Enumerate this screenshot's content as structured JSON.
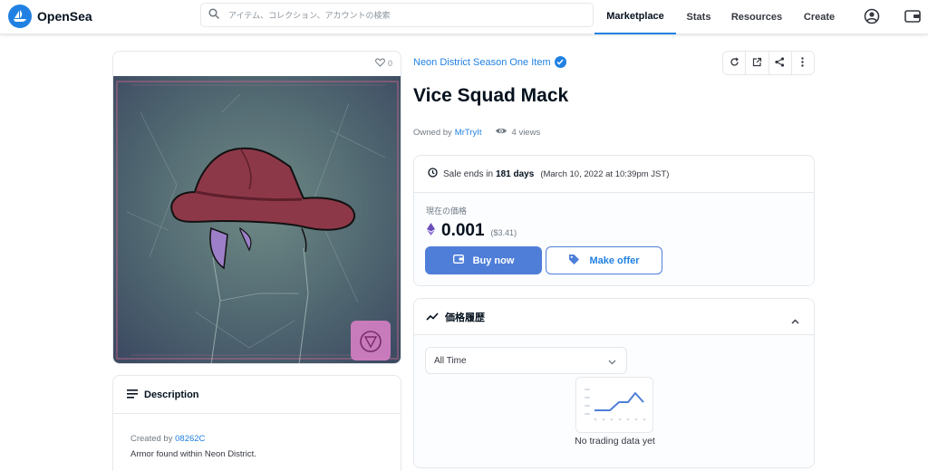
{
  "header": {
    "brand": "OpenSea",
    "search_placeholder": "アイテム、コレクション、アカウントの検索",
    "nav": [
      "Marketplace",
      "Stats",
      "Resources",
      "Create"
    ]
  },
  "asset": {
    "favorites_count": "0",
    "collection": "Neon District Season One Item",
    "title": "Vice Squad Mack",
    "owned_by_label": "Owned by",
    "owner": "MrTryIt",
    "views": "4 views"
  },
  "description": {
    "heading": "Description",
    "created_by_label": "Created by",
    "creator": "08262C",
    "text": "Armor found within Neon District."
  },
  "sale": {
    "ends_label": "Sale ends in",
    "ends_in": "181 days",
    "end_date": "(March 10, 2022 at 10:39pm JST)",
    "price_label": "現在の価格",
    "price": "0.001",
    "price_usd": "($3.41)",
    "buy_label": "Buy now",
    "offer_label": "Make offer"
  },
  "price_history": {
    "heading": "価格履歴",
    "range_selected": "All Time",
    "empty_text": "No trading data yet"
  },
  "colors": {
    "accent": "#2081e2",
    "buy_button": "#4f7ed9",
    "text_dark": "#04111d",
    "text_muted": "#707a83",
    "border": "#e5e8eb"
  },
  "icons": {
    "logo": "opensea-boat-icon",
    "search": "search-icon",
    "profile": "profile-icon",
    "wallet": "wallet-icon",
    "favorite": "heart-icon",
    "verified": "verified-badge-icon",
    "refresh": "refresh-icon",
    "external": "external-link-icon",
    "share": "share-icon",
    "more": "more-vertical-icon",
    "views": "eye-icon",
    "clock": "clock-icon",
    "eth": "eth-icon",
    "description": "list-icon",
    "history": "trending-icon"
  }
}
